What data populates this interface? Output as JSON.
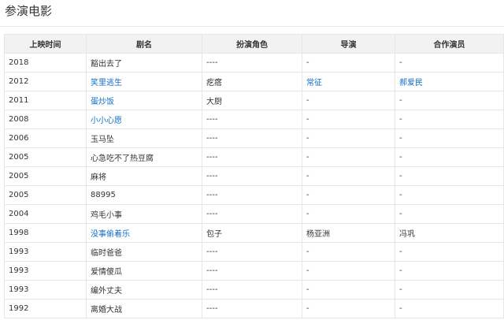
{
  "section": {
    "title": "参演电影"
  },
  "table": {
    "headers": {
      "year": "上映时间",
      "title": "剧名",
      "role": "扮演角色",
      "director": "导演",
      "costars": "合作演员"
    },
    "rows": [
      {
        "year": "2018",
        "title": "豁出去了",
        "title_link": false,
        "role": "----",
        "director": "-",
        "director_link": false,
        "costars": "-",
        "costars_link": false
      },
      {
        "year": "2012",
        "title": "笑里逃生",
        "title_link": true,
        "role": "疙瘩",
        "director": "常征",
        "director_link": true,
        "costars": "郝爱民",
        "costars_link": true
      },
      {
        "year": "2011",
        "title": "蛋炒饭",
        "title_link": true,
        "role": "大厨",
        "director": "-",
        "director_link": false,
        "costars": "-",
        "costars_link": false
      },
      {
        "year": "2008",
        "title": "小小心愿",
        "title_link": true,
        "role": "----",
        "director": "-",
        "director_link": false,
        "costars": "-",
        "costars_link": false
      },
      {
        "year": "2006",
        "title": "玉马坠",
        "title_link": false,
        "role": "----",
        "director": "-",
        "director_link": false,
        "costars": "-",
        "costars_link": false
      },
      {
        "year": "2005",
        "title": "心急吃不了热豆腐",
        "title_link": false,
        "role": "----",
        "director": "-",
        "director_link": false,
        "costars": "-",
        "costars_link": false
      },
      {
        "year": "2005",
        "title": "麻将",
        "title_link": false,
        "role": "----",
        "director": "-",
        "director_link": false,
        "costars": "-",
        "costars_link": false
      },
      {
        "year": "2005",
        "title": "88995",
        "title_link": false,
        "role": "----",
        "director": "-",
        "director_link": false,
        "costars": "-",
        "costars_link": false
      },
      {
        "year": "2004",
        "title": "鸡毛小事",
        "title_link": false,
        "role": "----",
        "director": "-",
        "director_link": false,
        "costars": "-",
        "costars_link": false
      },
      {
        "year": "1998",
        "title": "没事偷着乐",
        "title_link": true,
        "role": "包子",
        "director": "杨亚洲",
        "director_link": false,
        "costars": "冯巩",
        "costars_link": false
      },
      {
        "year": "1993",
        "title": "临时爸爸",
        "title_link": false,
        "role": "----",
        "director": "-",
        "director_link": false,
        "costars": "-",
        "costars_link": false
      },
      {
        "year": "1993",
        "title": "爱情傻瓜",
        "title_link": false,
        "role": "----",
        "director": "-",
        "director_link": false,
        "costars": "-",
        "costars_link": false
      },
      {
        "year": "1993",
        "title": "编外丈夫",
        "title_link": false,
        "role": "----",
        "director": "-",
        "director_link": false,
        "costars": "-",
        "costars_link": false
      },
      {
        "year": "1992",
        "title": "离婚大战",
        "title_link": false,
        "role": "----",
        "director": "-",
        "director_link": false,
        "costars": "-",
        "costars_link": false
      }
    ]
  },
  "colors": {
    "link": "#136ec2",
    "header_bg": "#f2f2f2",
    "border": "#e6e6e6",
    "text": "#333333"
  }
}
